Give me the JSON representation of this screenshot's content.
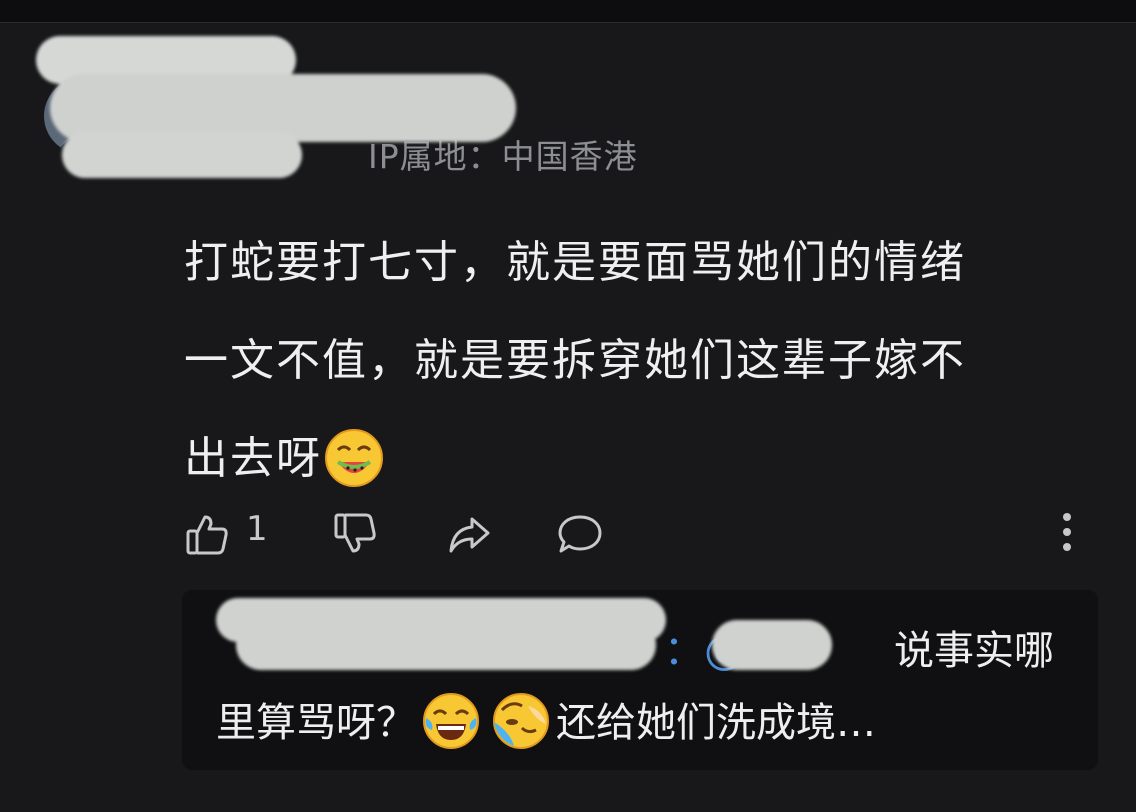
{
  "comment": {
    "location_label": "IP属地：中国香港",
    "content_line1": "打蛇要打七寸，就是要面骂她们的情绪",
    "content_line2": "一文不值，就是要拆穿她们这辈子嫁不",
    "content_line3": "出去呀",
    "emoji_icon": "eating-watermelon-emoji-icon"
  },
  "actions": {
    "like_count": "1",
    "icons": [
      "thumbs-up-icon",
      "thumbs-down-icon",
      "share-icon",
      "comment-icon",
      "more-vertical-icon"
    ]
  },
  "reply": {
    "author_suffix": "：@",
    "text_part1": "说事实哪",
    "text_part2": "里算骂呀？",
    "text_part3": "还给她们洗成境…",
    "emoji_icons": [
      "laughing-tears-emoji-icon",
      "blushing-embarrassed-emoji-icon"
    ]
  },
  "colors": {
    "background": "#18181a",
    "reply_background": "#101012",
    "link_blue": "#4a8ed8",
    "muted_text": "#8d8e93"
  }
}
